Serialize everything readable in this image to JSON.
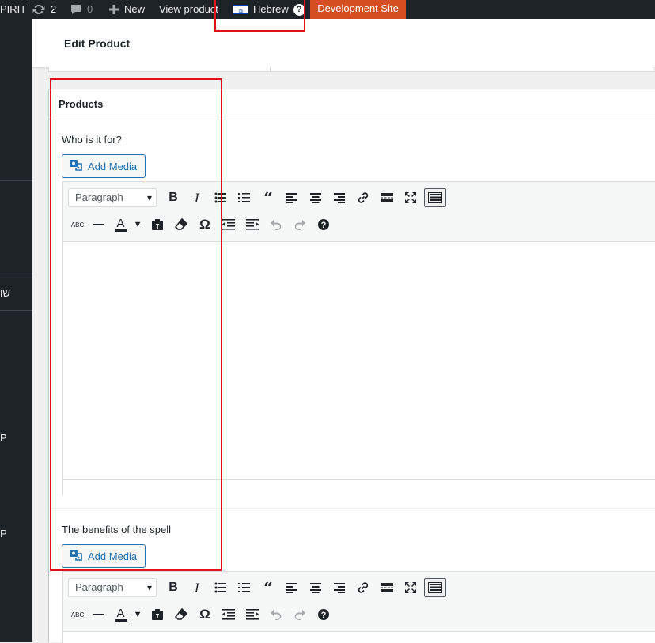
{
  "adminbar": {
    "site_name_fragment": "PIRIT",
    "updates_count": "2",
    "comments_count": "0",
    "new_label": "New",
    "view_product_label": "View product",
    "language_label": "Hebrew",
    "language_help": "?",
    "dev_site_label": "Development Site",
    "dev_site_color": "#d54e21"
  },
  "sidebar": {
    "label_hebrew": "שו",
    "label_p1": "P",
    "label_p2": "P"
  },
  "header": {
    "title": "Edit Product"
  },
  "metabox": {
    "title": "Products",
    "fields": [
      {
        "label": "Who is it for?",
        "add_media_label": "Add Media",
        "format_select": "Paragraph"
      },
      {
        "label": "The benefits of the spell",
        "add_media_label": "Add Media",
        "format_select": "Paragraph"
      }
    ]
  },
  "toolbar_icons": {
    "row1": [
      "bold-icon",
      "italic-icon",
      "bullet-list-icon",
      "numbered-list-icon",
      "blockquote-icon",
      "align-left-icon",
      "align-center-icon",
      "align-right-icon",
      "link-icon",
      "read-more-icon",
      "fullscreen-icon",
      "toolbar-toggle-icon"
    ],
    "row2": [
      "strikethrough-icon",
      "horizontal-line-icon",
      "text-color-icon",
      "paste-text-icon",
      "clear-formatting-icon",
      "special-character-icon",
      "outdent-icon",
      "indent-icon",
      "undo-icon",
      "redo-icon",
      "help-icon"
    ]
  },
  "colors": {
    "highlight_box": "#e3101c",
    "link": "#2271b1"
  }
}
